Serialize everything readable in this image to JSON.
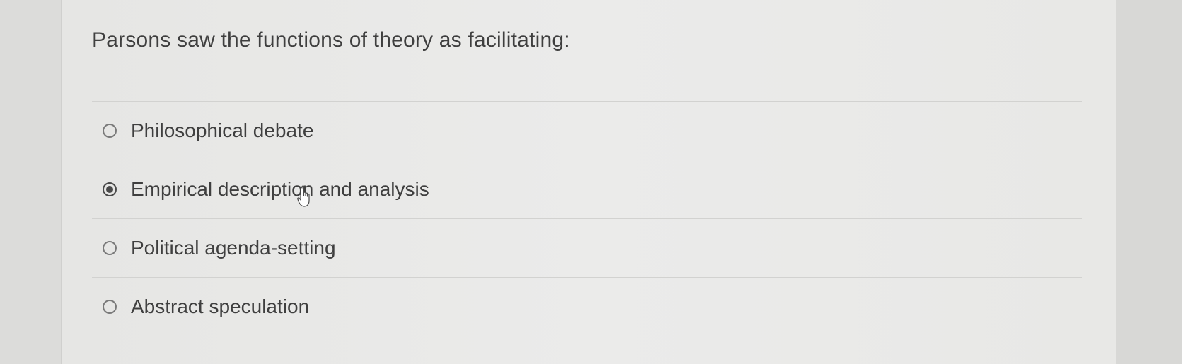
{
  "question": {
    "text": "Parsons saw the functions of theory as facilitating:"
  },
  "options": [
    {
      "label": "Philosophical debate",
      "selected": false
    },
    {
      "label": "Empirical description and analysis",
      "selected": true
    },
    {
      "label": "Political agenda-setting",
      "selected": false
    },
    {
      "label": "Abstract speculation",
      "selected": false
    }
  ],
  "colors": {
    "background": "#e8e8e6",
    "text": "#3f3f3f",
    "radio_border": "#7a7a7a",
    "radio_fill": "#4a4a4a",
    "divider": "#d2d2d0"
  },
  "cursor": {
    "icon": "hand-pointer-icon"
  }
}
